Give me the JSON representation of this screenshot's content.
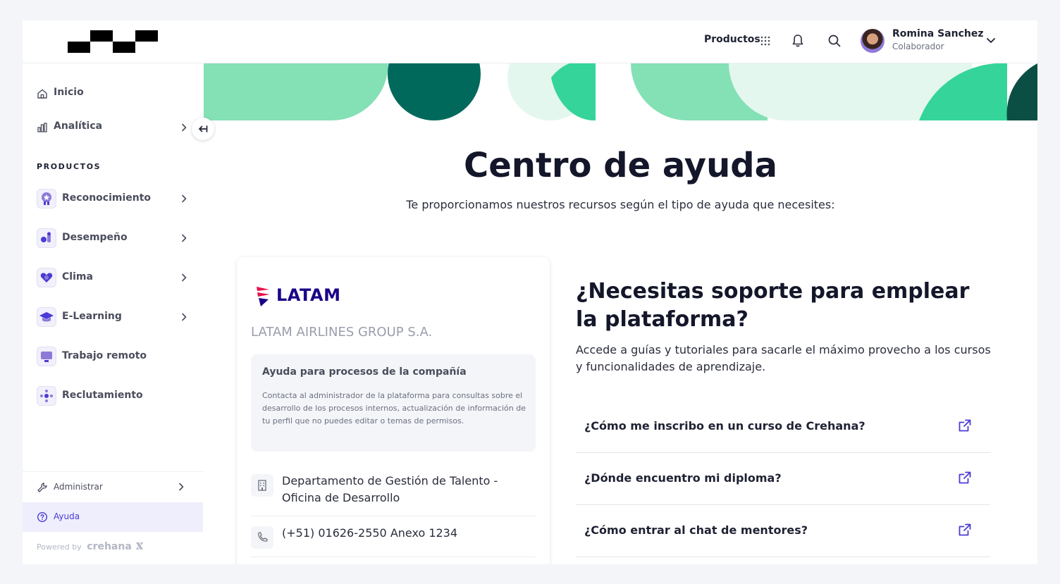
{
  "header": {
    "products_label": "Productos",
    "user_name": "Romina Sanchez",
    "user_role": "Colaborador"
  },
  "sidebar": {
    "top_items": [
      {
        "label": "Inicio",
        "icon": "home-icon"
      },
      {
        "label": "Analítica",
        "icon": "bar-chart-icon"
      }
    ],
    "section_title": "PRODUCTOS",
    "products": [
      {
        "label": "Reconocimiento",
        "icon": "medal-icon"
      },
      {
        "label": "Desempeño",
        "icon": "performance-icon"
      },
      {
        "label": "Clima",
        "icon": "heart-icon"
      },
      {
        "label": "E-Learning",
        "icon": "graduation-cap-icon"
      },
      {
        "label": "Trabajo remoto",
        "icon": "monitor-icon"
      },
      {
        "label": "Reclutamiento",
        "icon": "recruitment-icon"
      }
    ],
    "admin_label": "Administrar",
    "help_label": "Ayuda",
    "powered_label": "Powered by",
    "powered_brand": "crehana"
  },
  "main": {
    "title": "Centro de ayuda",
    "subtitle": "Te proporcionamos nuestros recursos según el tipo de ayuda que necesites:"
  },
  "company_card": {
    "logo_text": "LATAM",
    "company_name": "LATAM AIRLINES GROUP S.A.",
    "info_title": "Ayuda para procesos de la compañía",
    "info_text": "Contacta al administrador de la plataforma para consultas sobre el desarrollo de los procesos internos, actualización de información de tu perfil que no puedes editar o temas de permisos.",
    "department": "Departamento de Gestión de Talento - Oficina de Desarrollo",
    "phone": "(+51) 01626-2550 Anexo 1234"
  },
  "support": {
    "title": "¿Necesitas soporte para emplear la plataforma?",
    "description": "Accede a guías y tutoriales para sacarle el máximo provecho a los cursos y funcionalidades de aprendizaje.",
    "faqs": [
      "¿Cómo me inscribo en un curso de Crehana?",
      "¿Dónde encuentro mi diploma?",
      "¿Cómo entrar al chat de mentores?"
    ]
  },
  "colors": {
    "accent": "#4a3ad6",
    "banner_light": "#84e0b5",
    "banner_dark": "#00695c",
    "banner_mid": "#35d49a",
    "latam_blue": "#1b0088"
  }
}
